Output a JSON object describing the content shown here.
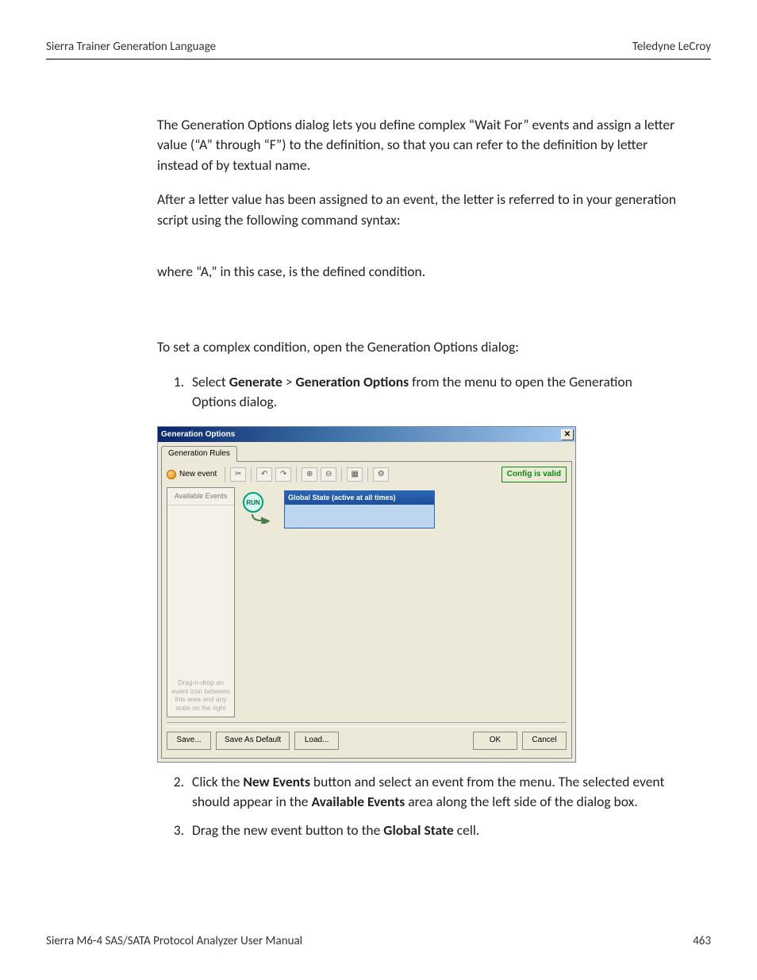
{
  "header": {
    "left": "Sierra Trainer Generation Language",
    "right": "Teledyne LeCroy"
  },
  "body": {
    "p1": "The Generation Options dialog lets you define complex “Wait For” events and assign a letter value (“A” through “F”) to the definition, so that you can refer to the definition by letter instead of by textual name.",
    "p2": "After a letter value has been assigned to an event, the letter is referred to in your generation script using the following command syntax:",
    "p3": "where “A,” in this case, is the defined condition.",
    "p4": "To set a complex condition, open the Generation Options dialog:",
    "step1_pre": "Select ",
    "step1_b1": "Generate",
    "step1_gt": " > ",
    "step1_b2": "Generation Options",
    "step1_post": " from the menu to open the Generation Options dialog.",
    "step2_pre": "Click the ",
    "step2_b1": "New Events",
    "step2_mid": " button and select an event from the menu. The selected event should appear in the ",
    "step2_b2": "Available Events",
    "step2_post": " area along the left side of the dialog box.",
    "step3_pre": "Drag the new event button to the ",
    "step3_b1": "Global State",
    "step3_post": " cell."
  },
  "dialog": {
    "title": "Generation Options",
    "close": "✕",
    "tab": "Generation Rules",
    "newevent": "New event",
    "status": "Config is valid",
    "available": "Available Events",
    "hint": "Drag-n-drop an event icon between this area and any state on the right",
    "run": "RUN",
    "gstate": "Global State (active at all times)",
    "buttons": {
      "save": "Save...",
      "savedef": "Save As Default",
      "load": "Load...",
      "ok": "OK",
      "cancel": "Cancel"
    },
    "icons": {
      "del": "✂",
      "undo": "↶",
      "redo": "↷",
      "zin": "⊕",
      "zout": "⊖",
      "fit": "▦",
      "cfg": "⚙"
    }
  },
  "footer": {
    "left": "Sierra M6-4 SAS/SATA Protocol Analyzer User Manual",
    "right": "463"
  }
}
